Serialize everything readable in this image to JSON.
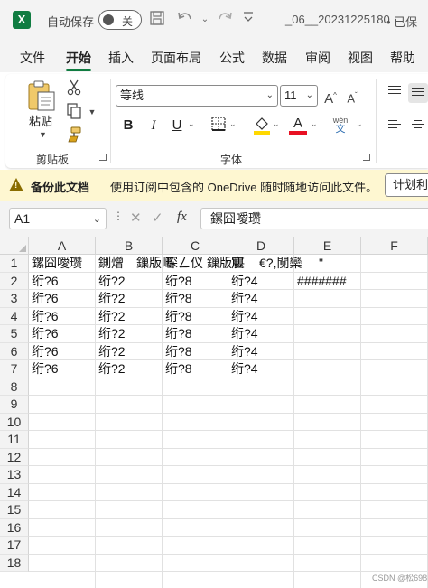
{
  "titlebar": {
    "app_icon": "X",
    "autosave_label": "自动保存",
    "toggle_state": "关",
    "filename": "_06__20231225180",
    "saved_status": "• 已保"
  },
  "menu": {
    "tabs": [
      "文件",
      "开始",
      "插入",
      "页面布局",
      "公式",
      "数据",
      "审阅",
      "视图",
      "帮助"
    ],
    "active": "开始"
  },
  "ribbon": {
    "clipboard": {
      "paste_label": "粘贴",
      "group_label": "剪贴板"
    },
    "font": {
      "font_name": "等线",
      "font_size": "11",
      "bold": "B",
      "italic": "I",
      "underline": "U",
      "font_color_glyph": "A",
      "phonetic_top": "wén",
      "phonetic_bottom": "文",
      "group_label": "字体",
      "fill_color": "#ffd800",
      "font_color": "#e81123"
    }
  },
  "infobar": {
    "title": "备份此文档",
    "message": "使用订阅中包含的 OneDrive 随时随地访问此文件。",
    "button": "计划利"
  },
  "formula_bar": {
    "name_box": "A1",
    "fx": "fx",
    "content": "鏍囧噯瓒"
  },
  "grid": {
    "columns": [
      "A",
      "B",
      "C",
      "D",
      "E",
      "F"
    ],
    "rows": [
      "1",
      "2",
      "3",
      "4",
      "5",
      "6",
      "7",
      "8",
      "9",
      "10",
      "11",
      "12",
      "13",
      "14",
      "15",
      "16",
      "17",
      "18"
    ],
    "header_row": [
      "鏍囧噯瓒",
      "鍘熷",
      "鏁版嵁",
      "琛ㄥ仪",
      "鏁版嵁",
      "宸",
      "€?,闃欒",
      "\""
    ],
    "data": [
      [
        "绗?6",
        "绗?2",
        "绗?8",
        "绗?4",
        "#######"
      ],
      [
        "绗?6",
        "绗?2",
        "绗?8",
        "绗?4",
        ""
      ],
      [
        "绗?6",
        "绗?2",
        "绗?8",
        "绗?4",
        ""
      ],
      [
        "绗?6",
        "绗?2",
        "绗?8",
        "绗?4",
        ""
      ],
      [
        "绗?6",
        "绗?2",
        "绗?8",
        "绗?4",
        ""
      ],
      [
        "绗?6",
        "绗?2",
        "绗?8",
        "绗?4",
        ""
      ]
    ]
  },
  "watermark": "CSDN @松698"
}
